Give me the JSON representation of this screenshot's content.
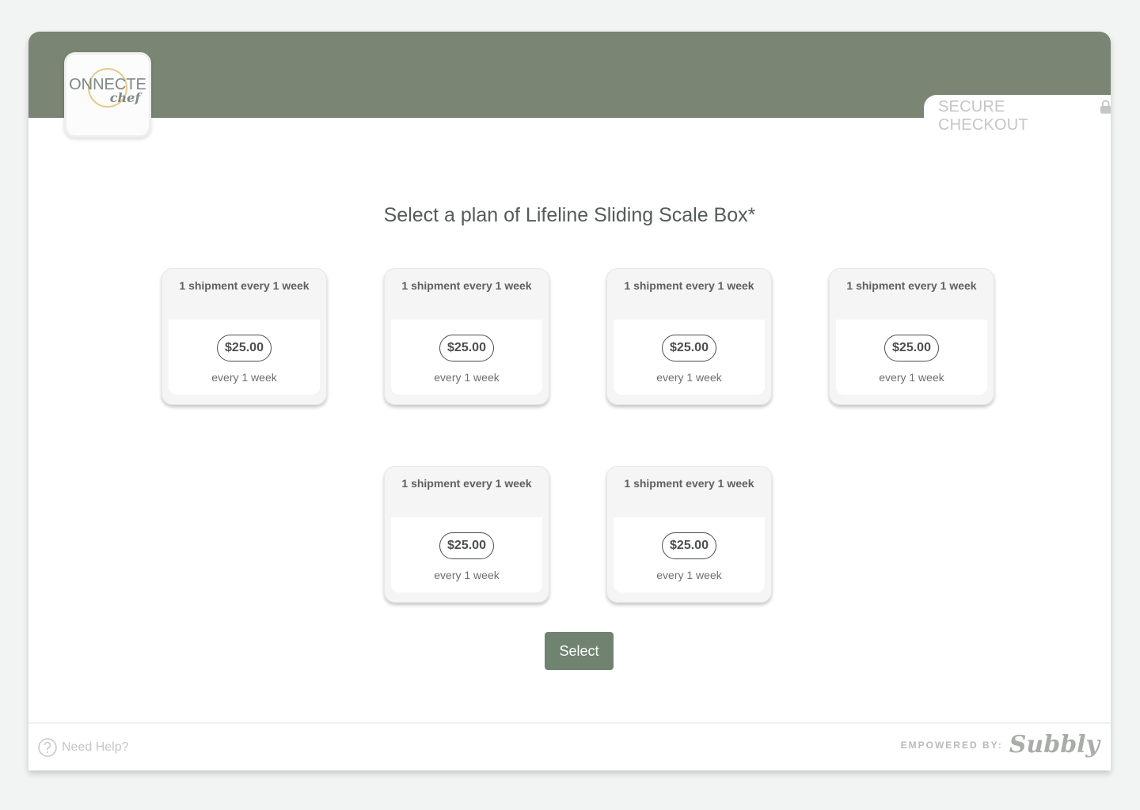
{
  "header": {
    "logo_line1": "CONNECTED",
    "logo_line2": "chef",
    "secure_label": "SECURE CHECKOUT",
    "band_color": "#7a8574",
    "lock_icon": "lock-icon"
  },
  "main": {
    "title": "Select a plan of Lifeline Sliding Scale Box*",
    "plans": [
      {
        "name": "1 shipment every 1 week",
        "price": "$25.00",
        "frequency": "every 1 week"
      },
      {
        "name": "1 shipment every 1 week",
        "price": "$25.00",
        "frequency": "every 1 week"
      },
      {
        "name": "1 shipment every 1 week",
        "price": "$25.00",
        "frequency": "every 1 week"
      },
      {
        "name": "1 shipment every 1 week",
        "price": "$25.00",
        "frequency": "every 1 week"
      },
      {
        "name": "1 shipment every 1 week",
        "price": "$25.00",
        "frequency": "every 1 week"
      },
      {
        "name": "1 shipment every 1 week",
        "price": "$25.00",
        "frequency": "every 1 week"
      }
    ],
    "select_label": "Select",
    "accent_color": "#6f8370"
  },
  "footer": {
    "help_label": "Need Help?",
    "help_icon": "question-circle-icon",
    "powered_label": "EMPOWERED BY:",
    "brand": "Subbly"
  }
}
